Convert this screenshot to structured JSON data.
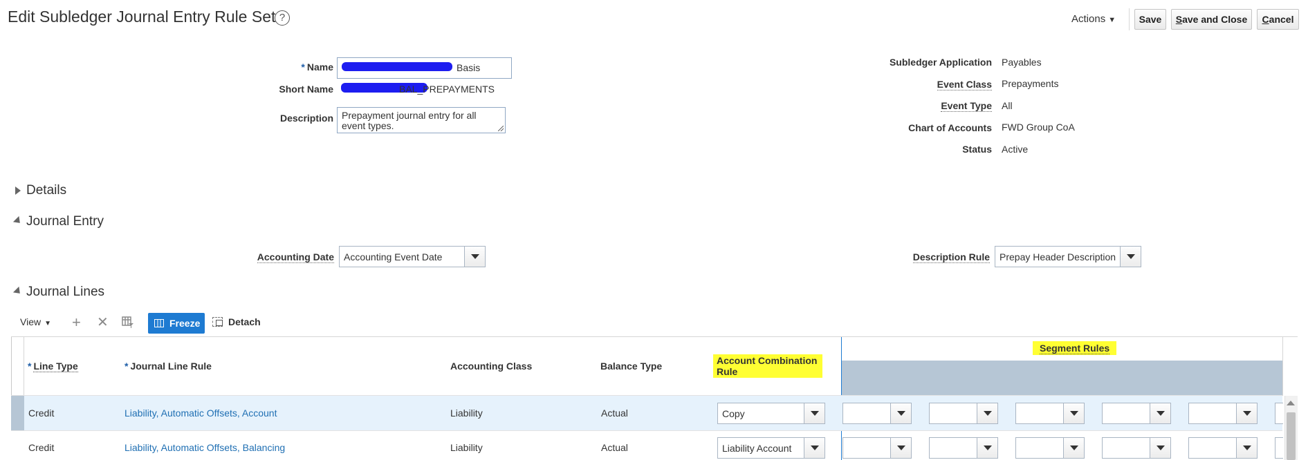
{
  "header": {
    "title": "Edit Subledger Journal Entry Rule Set",
    "help_glyph": "?",
    "actions_label": "Actions",
    "save_label": "Save",
    "save_close_prefix": "S",
    "save_close_rest": "ave and Close",
    "cancel_prefix": "C",
    "cancel_rest": "ancel"
  },
  "form_left": {
    "required_mark": "*",
    "name_label": "Name",
    "name_value_visible": "Basis",
    "short_name_label": "Short Name",
    "short_name_value_visible": "BAL_PREPAYMENTS",
    "description_label": "Description",
    "description_value": "Prepayment journal entry for all event types."
  },
  "form_right": {
    "subledger_application_label": "Subledger Application",
    "subledger_application_value": "Payables",
    "event_class_label": "Event Class",
    "event_class_value": "Prepayments",
    "event_type_label": "Event Type",
    "event_type_value": "All",
    "chart_of_accounts_label": "Chart of Accounts",
    "chart_of_accounts_value": "FWD Group CoA",
    "status_label": "Status",
    "status_value": "Active"
  },
  "sections": {
    "details": "Details",
    "journal_entry": "Journal Entry",
    "journal_lines": "Journal Lines"
  },
  "journal_entry": {
    "accounting_date_label": "Accounting Date",
    "accounting_date_value": "Accounting Event Date",
    "description_rule_label": "Description Rule",
    "description_rule_value": "Prepay Header Description"
  },
  "lines_toolbar": {
    "view_label": "View",
    "add_icon": "+",
    "delete_icon": "✕",
    "freeze_label": "Freeze",
    "detach_label": "Detach"
  },
  "table": {
    "required_mark": "*",
    "columns": {
      "line_type": "Line Type",
      "journal_line_rule": "Journal Line Rule",
      "accounting_class": "Accounting Class",
      "balance_type": "Balance Type",
      "account_combination_rule_1": "Account Combination",
      "account_combination_rule_2": "Rule",
      "segment_rules": "Segment Rules"
    },
    "rows": [
      {
        "line_type": "Credit",
        "journal_line_rule": "Liability, Automatic Offsets, Account",
        "accounting_class": "Liability",
        "balance_type": "Actual",
        "account_combination_rule": "Copy"
      },
      {
        "line_type": "Credit",
        "journal_line_rule": "Liability, Automatic Offsets, Balancing",
        "accounting_class": "Liability",
        "balance_type": "Actual",
        "account_combination_rule": "Liability Account"
      }
    ]
  },
  "colors": {
    "accent": "#1e7bd2",
    "link": "#1f6fb3",
    "highlight": "#ffff33",
    "redaction": "#1d1df0",
    "header_band": "#b6c6d5"
  }
}
